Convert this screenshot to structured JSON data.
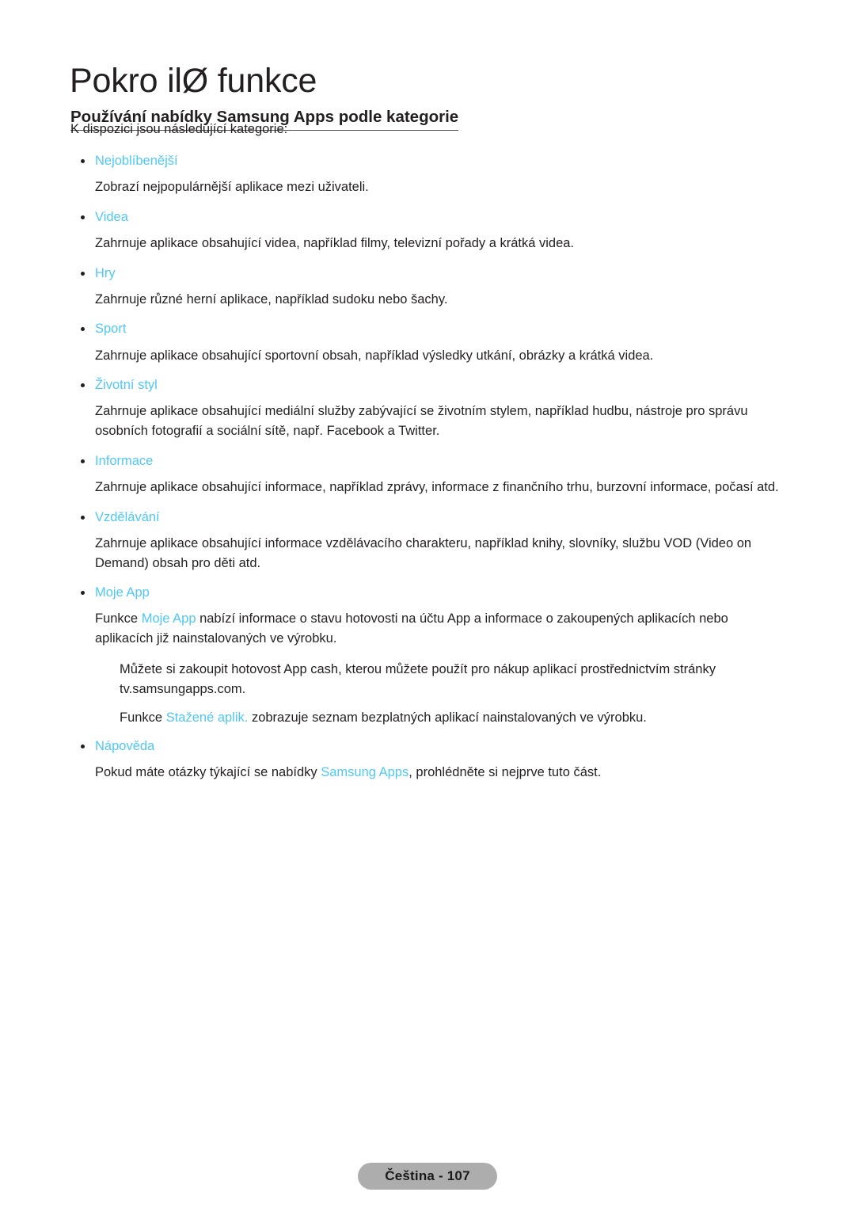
{
  "page": {
    "chapter_title": "Pokro ilØ funkce",
    "section_heading": "Používání nabídky Samsung Apps podle kategorie",
    "intro": "K dispozici jsou následující kategorie:",
    "accent_color": "#4fc8f5",
    "text_color": "#231f20",
    "footer_pill_color": "#adadad"
  },
  "categories": [
    {
      "label": "Nejoblíbenější",
      "description": "Zobrazí nejpopulárnější aplikace mezi uživateli."
    },
    {
      "label": "Videa",
      "description": "Zahrnuje aplikace obsahující videa, například filmy, televizní pořady a krátká videa."
    },
    {
      "label": "Hry",
      "description": "Zahrnuje různé herní aplikace, například sudoku nebo šachy."
    },
    {
      "label": "Sport",
      "description": "Zahrnuje aplikace obsahující sportovní obsah, například výsledky utkání, obrázky a krátká videa."
    },
    {
      "label": "Životní styl",
      "description": "Zahrnuje aplikace obsahující mediální služby zabývající se životním stylem, například hudbu, nástroje pro správu osobních fotografií a sociální sítě, např. Facebook a Twitter."
    },
    {
      "label": "Informace",
      "description": "Zahrnuje aplikace obsahující informace, například zprávy, informace z finančního trhu, burzovní informace, počasí atd."
    },
    {
      "label": "Vzdělávání",
      "description": "Zahrnuje aplikace obsahující informace vzdělávacího charakteru, například knihy, slovníky, službu VOD (Video on Demand) obsah pro děti atd."
    }
  ],
  "moje_app": {
    "label": "Moje App",
    "para1_before": "Funkce ",
    "para1_highlight": "Moje App",
    "para1_after": " nabízí informace o stavu hotovosti na účtu App a informace o zakoupených aplikacích nebo aplikacích již nainstalovaných ve výrobku.",
    "para2": "Můžete si zakoupit hotovost App cash, kterou můžete použít pro nákup aplikací prostřednictvím stránky tv.samsungapps.com.",
    "para3_before": "Funkce ",
    "para3_highlight": "Stažené aplik.",
    "para3_after": " zobrazuje seznam bezplatných aplikací nainstalovaných ve výrobku."
  },
  "napoveda": {
    "label": "Nápověda",
    "para_before": "Pokud máte otázky týkající se nabídky ",
    "para_highlight": "Samsung Apps",
    "para_after": ", prohlédněte si nejprve tuto část."
  },
  "footer": {
    "label": "Čeština - 107"
  }
}
